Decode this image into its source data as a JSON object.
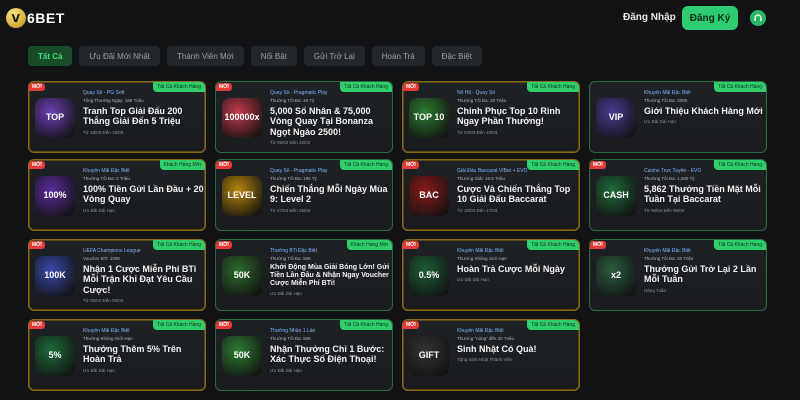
{
  "header": {
    "logo_mark": "V",
    "logo_text": "6BET",
    "login_label": "Đăng Nhập",
    "register_label": "Đăng Ký",
    "support_icon": "headset-icon",
    "brand_green": "#2ecc71"
  },
  "tabs": [
    {
      "label": "Tất Cả",
      "active": true
    },
    {
      "label": "Ưu Đãi Mới Nhất"
    },
    {
      "label": "Thành Viên Mới"
    },
    {
      "label": "Nổi Bật"
    },
    {
      "label": "Gửi Trở Lại"
    },
    {
      "label": "Hoàn Trả"
    },
    {
      "label": "Đặc Biệt"
    }
  ],
  "cards": [
    {
      "new": "MỚI",
      "tag": "Tất Cả Khách Hàng",
      "cat": "Quay Số - PG Soft",
      "meta": "Tổng Thưởng Ngày: 168 Triệu",
      "title": "Tranh Top Giải Đấu 200 Thắng Giải Đến 5 Triệu",
      "foot": "Từ 19/03 Đến 19/03",
      "art": "TOP",
      "art_color": "#6b3fb3"
    },
    {
      "new": "MỚI",
      "tag": "Tất Cả Khách Hàng",
      "cat": "Quay Số - Pragmatic Play",
      "meta": "Thưởng Tối Đa: 48 Tỷ",
      "title": "5,000 Số Nhân & 75,000 Vòng Quay Tại Bonanza Ngọt Ngào 2500!",
      "foot": "Từ 05/03 Đến 18/03",
      "art": "100000x",
      "art_color": "#c23b4a"
    },
    {
      "new": "MỚI",
      "tag": "Tất Cả Khách Hàng",
      "cat": "Nổ Hũ - Quay Số",
      "meta": "Thưởng Tối Đa: 20 Triệu",
      "title": "Chinh Phục Top 10 Rinh Ngay Phần Thưởng!",
      "foot": "Từ 04/03 Đến 18/03",
      "art": "TOP 10",
      "art_color": "#2e7d32"
    },
    {
      "new": "",
      "tag": "Tất Cả Khách Hàng",
      "cat": "Khuyến Mãi Đặc Biệt",
      "meta": "Thưởng Tối Đa: 200K",
      "title": "Giới Thiệu Khách Hàng Mới",
      "foot": "Ưu Đãi Dài Hạn",
      "art": "VIP",
      "art_color": "#4a3a8f"
    },
    {
      "new": "MỚI",
      "tag": "Khách Hàng Mới",
      "cat": "Khuyến Mãi Đặc Biệt",
      "meta": "Thưởng Tối Đa: 2 Triệu",
      "title": "100% Tiền Gửi Lần Đầu + 20 Vòng Quay",
      "foot": "Ưu Đãi Dài Hạn",
      "art": "100%",
      "art_color": "#5b2d9e"
    },
    {
      "new": "MỚI",
      "tag": "Tất Cả Khách Hàng",
      "cat": "Quay Số - Pragmatic Play",
      "meta": "Thưởng Tối Đa: 195 Tỷ",
      "title": "Chiến Thắng Mỗi Ngày Mùa 9: Level 2",
      "foot": "Từ 27/04 Đến 26/04",
      "art": "LEVEL",
      "art_color": "#b8860b"
    },
    {
      "new": "MỚI",
      "tag": "Tất Cả Khách Hàng",
      "cat": "Giải Đấu Baccarat VIBet + EVO",
      "meta": "Thưởng Giải: 16.5 Triệu",
      "title": "Cược Và Chiến Thắng Top 10 Giải Đấu Baccarat",
      "foot": "Từ 10/03 Đến 17/03",
      "art": "BAC",
      "art_color": "#8b1a1a"
    },
    {
      "new": "MỚI",
      "tag": "Tất Cả Khách Hàng",
      "cat": "Casino Trực Tuyến - EVO",
      "meta": "Thưởng Tối Đa: 1,000 Tỷ",
      "title": "5,862 Thưởng Tiền Mặt Mỗi Tuần Tại Baccarat",
      "foot": "Từ 06/04 Đến 06/04",
      "art": "CASH",
      "art_color": "#1e6b3a"
    },
    {
      "new": "MỚI",
      "tag": "Tất Cả Khách Hàng",
      "cat": "UEFA Champions League",
      "meta": "Voucher BTi: 100K",
      "title": "Nhận 1 Cược Miễn Phí BTi Mỗi Trận Khi Đạt Yêu Cầu Cược!",
      "foot": "Từ 05/04 Đến 08/04",
      "art": "100K",
      "art_color": "#3949ab"
    },
    {
      "new": "MỚI",
      "tag": "Khách Hàng Mới",
      "cat": "Thưởng BTi Đặc Biệt",
      "meta": "Thưởng Tối Đa: 50K",
      "title": "Khởi Động Mùa Giải Bóng Lớn! Gửi Tiền Lần Đầu & Nhận Ngay Voucher Cược Miễn Phí BTi!",
      "foot": "Ưu Đãi Dài Hạn",
      "art": "50K",
      "art_color": "#2e6b2e"
    },
    {
      "new": "MỚI",
      "tag": "Tất Cả Khách Hàng",
      "cat": "Khuyến Mãi Đặc Biệt",
      "meta": "Thưởng Không Giới Hạn",
      "title": "Hoàn Trả Cược Mỗi Ngày",
      "foot": "Ưu Đãi Dài Hạn",
      "art": "0.5%",
      "art_color": "#1d5e36"
    },
    {
      "new": "MỚI",
      "tag": "Tất Cả Khách Hàng",
      "cat": "Khuyến Mãi Đặc Biệt",
      "meta": "Thưởng Tối Đa: 20 Triệu",
      "title": "Thưởng Gửi Trở Lại 2 Lần Mỗi Tuần",
      "foot": "Hàng Tuần",
      "art": "x2",
      "art_color": "#2b5d3f"
    },
    {
      "new": "MỚI",
      "tag": "Tất Cả Khách Hàng",
      "cat": "Khuyến Mãi Đặc Biệt",
      "meta": "Thưởng Không Giới Hạn",
      "title": "Thưởng Thêm 5% Trên Hoàn Trả",
      "foot": "Ưu Đãi Dài Hạn",
      "art": "5%",
      "art_color": "#1e6b3a"
    },
    {
      "new": "MỚI",
      "tag": "Tất Cả Khách Hàng",
      "cat": "Thưởng Nhận 1 Lần",
      "meta": "Thưởng Tối Đa: 50K",
      "title": "Nhận Thưởng Chỉ 1 Bước: Xác Thực Số Điện Thoại!",
      "foot": "Ưu Đãi Dài Hạn",
      "art": "50K",
      "art_color": "#2e7d32"
    },
    {
      "new": "MỚI",
      "tag": "Tất Cả Khách Hàng",
      "cat": "Khuyến Mãi Đặc Biệt",
      "meta": "Thưởng \"nóng\" đến 20 Triệu",
      "title": "Sinh Nhật Có Quà!",
      "foot": "Tặng Sinh Nhật Thành Viên",
      "art": "GIFT",
      "art_color": "#333333"
    }
  ]
}
